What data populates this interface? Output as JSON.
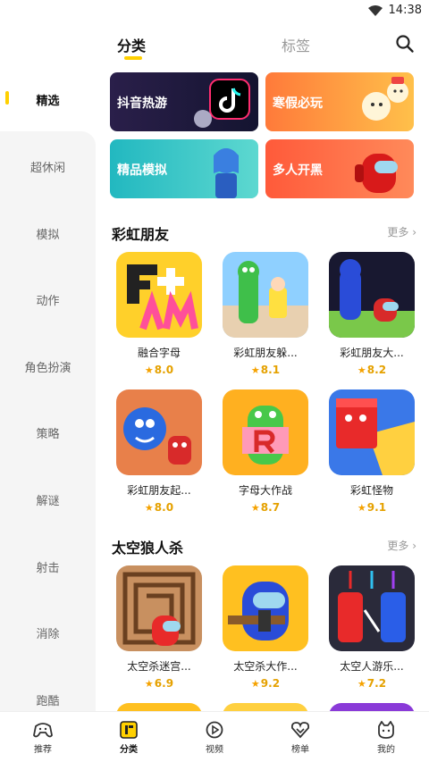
{
  "status_bar": {
    "time": "14:38",
    "wifi_icon": "wifi-icon"
  },
  "tabs": {
    "active": "分类",
    "inactive": "标签"
  },
  "search_icon": "search-icon",
  "sidebar": {
    "items": [
      {
        "label": "精选"
      },
      {
        "label": "超休闲"
      },
      {
        "label": "模拟"
      },
      {
        "label": "动作"
      },
      {
        "label": "角色扮演"
      },
      {
        "label": "策略"
      },
      {
        "label": "解谜"
      },
      {
        "label": "射击"
      },
      {
        "label": "消除"
      },
      {
        "label": "跑酷"
      }
    ]
  },
  "banners": [
    {
      "label": "抖音热游",
      "color": "#1a1a3a"
    },
    {
      "label": "寒假必玩",
      "color": "#ff8a3d"
    },
    {
      "label": "精品模拟",
      "color": "#2ec4c4"
    },
    {
      "label": "多人开黑",
      "color": "#ff6a4a"
    }
  ],
  "sections": [
    {
      "title": "彩虹朋友",
      "more": "更多",
      "games": [
        {
          "name": "融合字母",
          "rating": "8.0"
        },
        {
          "name": "彩虹朋友躲...",
          "rating": "8.1"
        },
        {
          "name": "彩虹朋友大...",
          "rating": "8.2"
        },
        {
          "name": "彩虹朋友起...",
          "rating": "8.0"
        },
        {
          "name": "字母大作战",
          "rating": "8.7"
        },
        {
          "name": "彩虹怪物",
          "rating": "9.1"
        }
      ]
    },
    {
      "title": "太空狼人杀",
      "more": "更多",
      "games": [
        {
          "name": "太空杀迷宫...",
          "rating": "6.9"
        },
        {
          "name": "太空杀大作...",
          "rating": "9.2"
        },
        {
          "name": "太空人游乐...",
          "rating": "7.2"
        }
      ]
    }
  ],
  "bottom_nav": [
    {
      "label": "推荐"
    },
    {
      "label": "分类"
    },
    {
      "label": "视频"
    },
    {
      "label": "榜单"
    },
    {
      "label": "我的"
    }
  ],
  "colors": {
    "accent": "#ffd000",
    "rating": "#f5a200"
  }
}
